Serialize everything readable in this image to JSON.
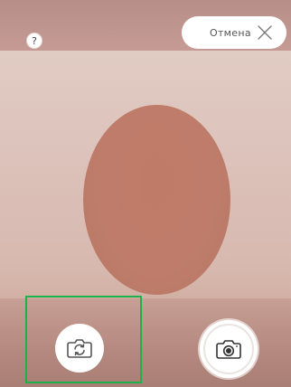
{
  "help": {
    "label": "?"
  },
  "cancel": {
    "label": "Отмена"
  },
  "icons": {
    "help": "question-mark-icon",
    "cancel": "close-icon",
    "switch_camera": "camera-switch-icon",
    "shutter": "camera-icon"
  },
  "colors": {
    "highlight": "#1bb24a",
    "face_oval": "#bf7c6a"
  }
}
